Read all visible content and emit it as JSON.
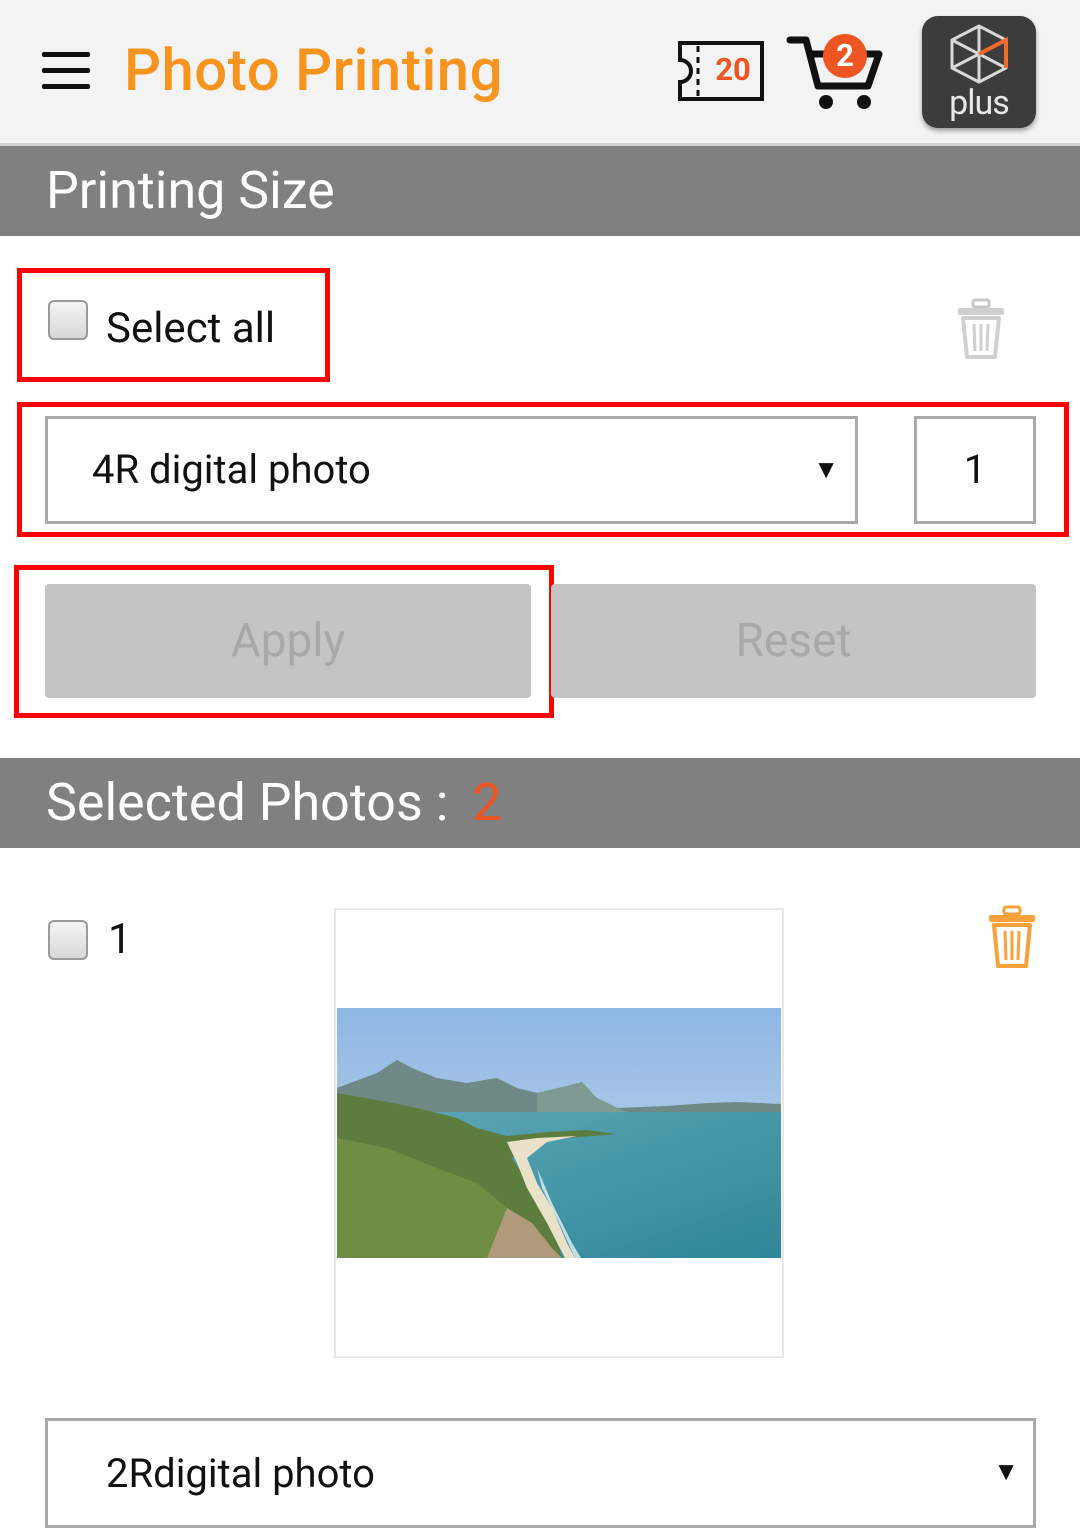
{
  "header": {
    "title": "Photo Printing",
    "coupon_count": "20",
    "cart_count": "2",
    "plus_label": "plus"
  },
  "printing_size": {
    "section_title": "Printing Size",
    "select_all_label": "Select all",
    "size_value": "4R digital photo",
    "quantity": "1",
    "apply_label": "Apply",
    "reset_label": "Reset"
  },
  "selected_photos": {
    "section_title": "Selected Photos :",
    "count": "2",
    "items": [
      {
        "index": "1",
        "size_value": "2Rdigital photo"
      }
    ]
  },
  "colors": {
    "brand_orange": "#f7941d",
    "badge_red": "#ef5423",
    "section_gray": "#808080",
    "highlight_red": "#ff0000"
  },
  "icons": [
    "menu-icon",
    "coupon-icon",
    "cart-icon",
    "plus-logo-icon",
    "trash-icon"
  ]
}
